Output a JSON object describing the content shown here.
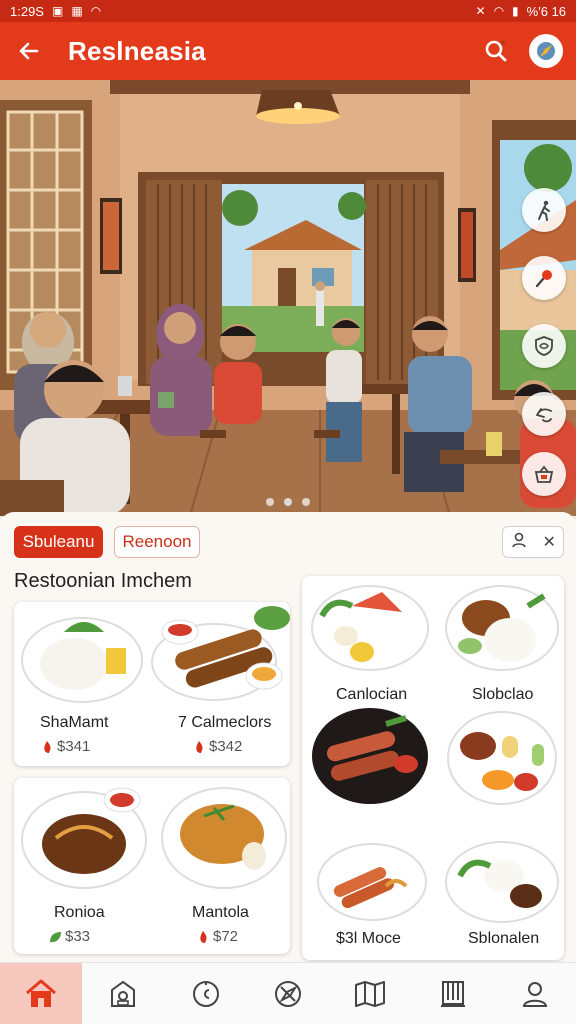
{
  "status_bar": {
    "time": "1:29S",
    "right_text": "%'6 16"
  },
  "app_bar": {
    "title": "Reslneasia"
  },
  "hero": {
    "active_slide": 2,
    "slide_count": 3
  },
  "filters": {
    "chip_active": "Sbuleanu",
    "chip_inactive": "Reenoon"
  },
  "section": {
    "title": "Restoonian Imchem"
  },
  "dishes": [
    {
      "name": "ShaMamt",
      "price": "$341"
    },
    {
      "name": "7 Calmeclors",
      "price": "$342"
    },
    {
      "name": "Ronioa",
      "price": "$33"
    },
    {
      "name": "Mantola",
      "price": "$72"
    },
    {
      "name": "Canlocian",
      "price": ""
    },
    {
      "name": "Slobclao",
      "price": ""
    },
    {
      "name": "$3l Moce",
      "price": ""
    },
    {
      "name": "Sblonalen",
      "price": ""
    }
  ],
  "colors": {
    "primary": "#e33a1c",
    "primary_dark": "#c72a14",
    "active_nav_bg": "#f7c8bd"
  },
  "nav": [
    "home-icon",
    "bag-icon",
    "clock-icon",
    "explore-icon",
    "map-icon",
    "menu-book-icon",
    "profile-icon"
  ]
}
